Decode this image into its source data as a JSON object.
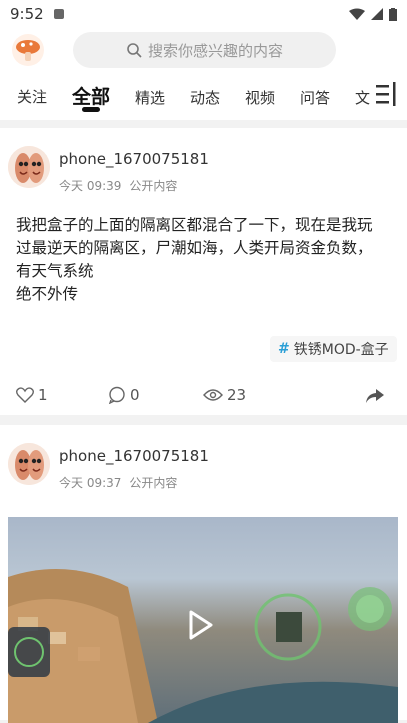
{
  "status_bar": {
    "time": "9:52"
  },
  "search": {
    "placeholder": "搜索你感兴趣的内容"
  },
  "tabs": [
    {
      "label": "关注"
    },
    {
      "label": "全部"
    },
    {
      "label": "精选"
    },
    {
      "label": "动态"
    },
    {
      "label": "视频"
    },
    {
      "label": "问答"
    },
    {
      "label": "文"
    }
  ],
  "posts": [
    {
      "username": "phone_1670075181",
      "time": "今天 09:39",
      "visibility": "公开内容",
      "text_line1": "我把盒子的上面的隔离区都混合了一下，现在是我玩",
      "text_line2": "过最逆天的隔离区，尸潮如海，人类开局资金负数，",
      "text_line3": "有天气系统",
      "text_line4": "绝不外传",
      "tag": "铁锈MOD-盒子",
      "likes": "1",
      "comments": "0",
      "views": "23"
    },
    {
      "username": "phone_1670075181",
      "time": "今天 09:37",
      "visibility": "公开内容"
    }
  ]
}
